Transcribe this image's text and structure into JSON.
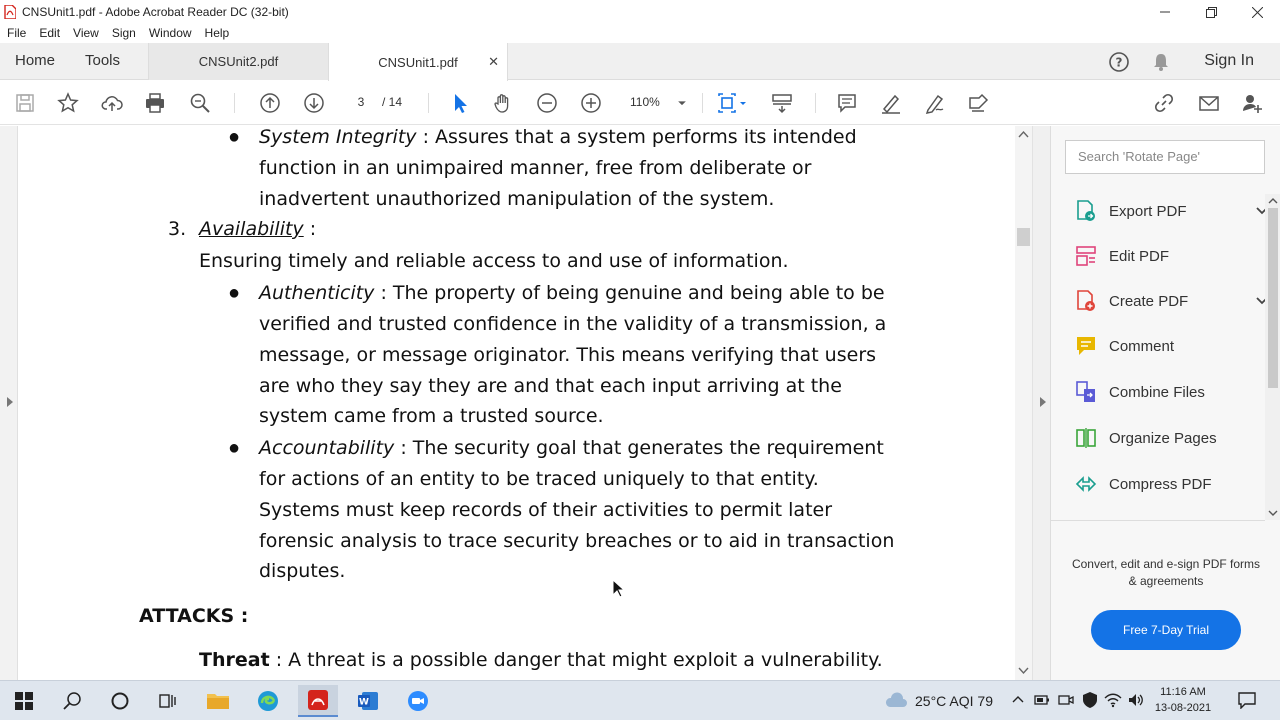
{
  "window": {
    "title": "CNSUnit1.pdf - Adobe Acrobat Reader DC (32-bit)"
  },
  "menu": [
    "File",
    "Edit",
    "View",
    "Sign",
    "Window",
    "Help"
  ],
  "tabs": {
    "home": "Home",
    "tools": "Tools",
    "documents": [
      {
        "label": "CNSUnit2.pdf",
        "active": false
      },
      {
        "label": "CNSUnit1.pdf",
        "active": true
      }
    ],
    "signin": "Sign In"
  },
  "toolbar": {
    "page_current": "3",
    "page_total": "/ 14",
    "zoom": "110%"
  },
  "document": {
    "lines": {
      "l1_term": "System Integrity",
      "l1_rest": " : Assures that a system performs its intended",
      "l2": "function in an unimpaired manner, free from deliberate or",
      "l3": "inadvertent unauthorized manipulation of the system.",
      "l4_num": "3.",
      "l4_term": "Availability",
      "l4_rest": " :",
      "l5": "Ensuring timely and reliable access to and use of information.",
      "l6_term": "Authenticity",
      "l6_rest": " : The property of being genuine and being able to be",
      "l7": "verified and trusted confidence in the validity of a transmission, a",
      "l8": "message, or message originator. This means verifying that users",
      "l9": "are who they say they are and that each input arriving at the",
      "l10": "system came from a trusted source.",
      "l11_term": "Accountability",
      "l11_rest": " : The security goal that generates the requirement",
      "l12": "for actions of an entity to be traced uniquely to that entity.",
      "l13": "Systems must keep records of their activities to permit later",
      "l14": "forensic analysis to trace security breaches or to aid in transaction",
      "l15": "disputes.",
      "l16": "ATTACKS :",
      "l17_term": "Threat",
      "l17_rest": " : A threat is a possible danger that might exploit a vulnerability."
    }
  },
  "right_pane": {
    "search_placeholder": "Search 'Rotate Page'",
    "tools": [
      {
        "label": "Export PDF",
        "icon": "export-pdf-icon",
        "color": "#1a9e8f",
        "expandable": true
      },
      {
        "label": "Edit PDF",
        "icon": "edit-pdf-icon",
        "color": "#e0457b",
        "expandable": false
      },
      {
        "label": "Create PDF",
        "icon": "create-pdf-icon",
        "color": "#e0453a",
        "expandable": true
      },
      {
        "label": "Comment",
        "icon": "comment-icon",
        "color": "#e8b700",
        "expandable": false
      },
      {
        "label": "Combine Files",
        "icon": "combine-files-icon",
        "color": "#5b5bd6",
        "expandable": false
      },
      {
        "label": "Organize Pages",
        "icon": "organize-pages-icon",
        "color": "#3aa53a",
        "expandable": false
      },
      {
        "label": "Compress PDF",
        "icon": "compress-pdf-icon",
        "color": "#1a9e8f",
        "expandable": false
      }
    ],
    "promo": "Convert, edit and e-sign PDF forms & agreements",
    "trial_button": "Free 7-Day Trial"
  },
  "taskbar": {
    "weather": "25°C AQI 79",
    "time": "11:16 AM",
    "date": "13-08-2021"
  },
  "colors": {
    "accent": "#1473e6",
    "acrobat_red": "#d4241c"
  }
}
